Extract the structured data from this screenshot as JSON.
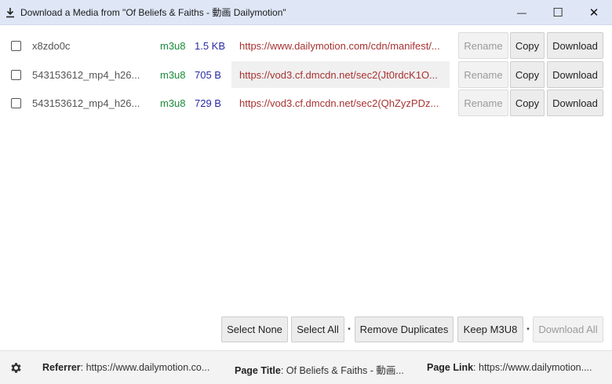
{
  "window": {
    "title": "Download a Media from \"Of Beliefs & Faiths - 動画 Dailymotion\"",
    "minimize_glyph": "—",
    "maximize_glyph": "☐",
    "close_glyph": "✕"
  },
  "rows": [
    {
      "name": "x8zdo0c",
      "ext": "m3u8",
      "size": "1.5 KB",
      "url": "https://www.dailymotion.com/cdn/manifest/...",
      "rename": "Rename",
      "copy": "Copy",
      "download": "Download"
    },
    {
      "name": "543153612_mp4_h26...",
      "ext": "m3u8",
      "size": "705 B",
      "url": "https://vod3.cf.dmcdn.net/sec2(Jt0rdcK1O...",
      "rename": "Rename",
      "copy": "Copy",
      "download": "Download"
    },
    {
      "name": "543153612_mp4_h26...",
      "ext": "m3u8",
      "size": "729 B",
      "url": "https://vod3.cf.dmcdn.net/sec2(QhZyzPDz...",
      "rename": "Rename",
      "copy": "Copy",
      "download": "Download"
    }
  ],
  "actions": {
    "select_none": "Select None",
    "select_all": "Select All",
    "remove_duplicates": "Remove Duplicates",
    "keep_m3u8": "Keep M3U8",
    "download_all": "Download All",
    "separator": "•"
  },
  "footer": {
    "referrer_label": "Referrer",
    "referrer_value": ": https://www.dailymotion.co...",
    "page_title_label": "Page Title",
    "page_title_value": ": Of Beliefs & Faiths - 動画...",
    "page_link_label": "Page Link",
    "page_link_value": ": https://www.dailymotion...."
  },
  "colors": {
    "titlebar": "#dfe7f7",
    "ext": "#1a8a3a",
    "size": "#2a2aa8",
    "url": "#a83232"
  },
  "icons": [
    "download-icon",
    "minimize-icon",
    "maximize-icon",
    "close-icon",
    "gear-icon"
  ]
}
